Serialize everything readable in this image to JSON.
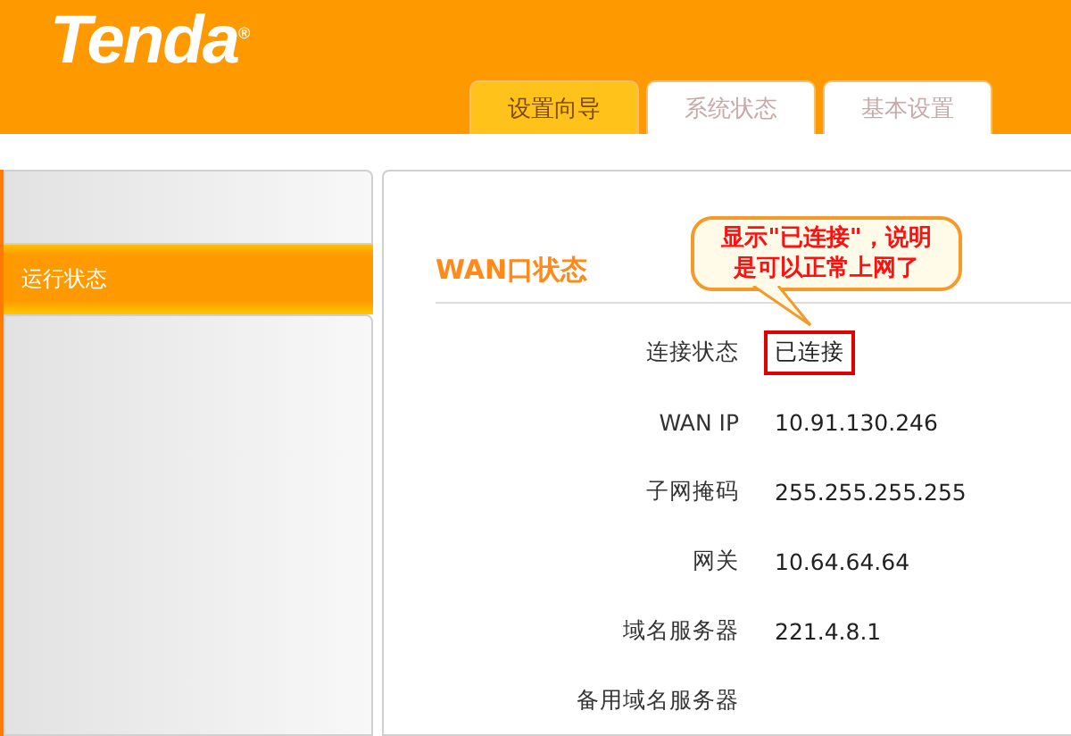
{
  "header": {
    "logo": "Tenda",
    "logo_mark": "®"
  },
  "tabs": [
    {
      "label": "设置向导",
      "selected": true
    },
    {
      "label": "系统状态",
      "selected": false
    },
    {
      "label": "基本设置",
      "selected": false
    }
  ],
  "sidebar": {
    "items": [
      {
        "label": "运行状态",
        "selected": true
      }
    ]
  },
  "section": {
    "title": "WAN口状态"
  },
  "rows": [
    {
      "label": "连接状态",
      "value": "已连接",
      "highlighted": true
    },
    {
      "label": "WAN IP",
      "value": "10.91.130.246"
    },
    {
      "label": "子网掩码",
      "value": "255.255.255.255"
    },
    {
      "label": "网关",
      "value": "10.64.64.64"
    },
    {
      "label": "域名服务器",
      "value": "221.4.8.1"
    },
    {
      "label": "备用域名服务器"
    }
  ],
  "callout": {
    "lines": [
      "显示\"已连接\"，说明",
      "是可以正常上网了"
    ]
  }
}
